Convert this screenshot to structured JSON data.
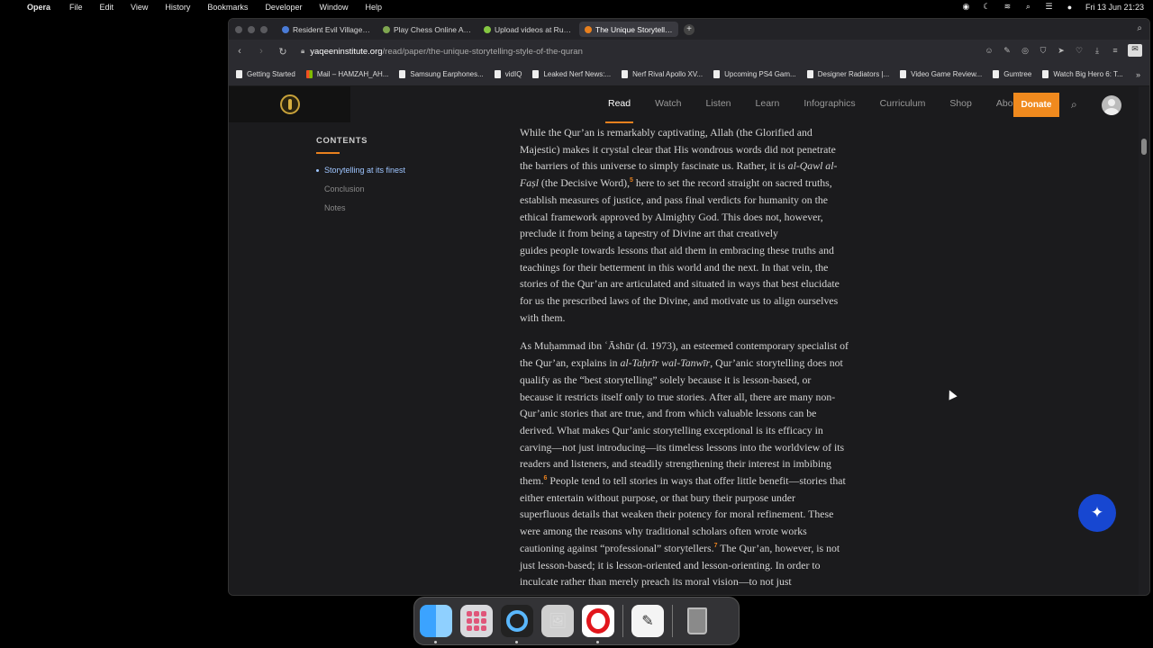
{
  "menubar": {
    "app": "Opera",
    "items": [
      "File",
      "Edit",
      "View",
      "History",
      "Bookmarks",
      "Developer",
      "Window",
      "Help"
    ],
    "clock": "Fri 13 Jun  21:23"
  },
  "tabs": [
    {
      "label": "Resident Evil Village - H",
      "color": "#4a7bd6"
    },
    {
      "label": "Play Chess Online Again",
      "color": "#7fa650"
    },
    {
      "label": "Upload videos at Rumble",
      "color": "#85c742"
    },
    {
      "label": "The Unique Storytelling",
      "color": "#e8801e",
      "active": true
    }
  ],
  "address": {
    "domain": "yaqeeninstitute.org",
    "path": "/read/paper/the-unique-storytelling-style-of-the-quran"
  },
  "bookmarks": [
    {
      "label": "Getting Started",
      "icon": "page"
    },
    {
      "label": "Mail – HAMZAH_AH...",
      "icon": "mail"
    },
    {
      "label": "Samsung Earphones...",
      "icon": "page"
    },
    {
      "label": "vidIQ",
      "icon": "page"
    },
    {
      "label": "Leaked Nerf News:...",
      "icon": "page"
    },
    {
      "label": "Nerf Rival Apollo XV...",
      "icon": "page"
    },
    {
      "label": "Upcoming PS4 Gam...",
      "icon": "page"
    },
    {
      "label": "Designer Radiators |...",
      "icon": "page"
    },
    {
      "label": "Video Game Review...",
      "icon": "page"
    },
    {
      "label": "Gumtree",
      "icon": "page"
    },
    {
      "label": "Watch Big Hero 6: T...",
      "icon": "page"
    }
  ],
  "site_nav": {
    "links": [
      "Read",
      "Watch",
      "Listen",
      "Learn",
      "Infographics",
      "Curriculum",
      "Shop",
      "About"
    ],
    "active": "Read",
    "donate": "Donate",
    "accent": "#f08a1e"
  },
  "toc": {
    "title": "CONTENTS",
    "items": [
      "Storytelling at its finest",
      "Conclusion",
      "Notes"
    ],
    "active": "Storytelling at its finest"
  },
  "article": {
    "p1": [
      "While the Qur’an is remarkably captivating, Allah (the Glorified and",
      "Majestic) makes it crystal clear that His wondrous words did not penetrate",
      "the barriers of this universe to simply fascinate us. Rather, it is ",
      "al-Qawl al-",
      "Faṣl",
      " (the Decisive Word),",
      "5",
      " here to set the record straight on sacred truths,",
      "establish measures of justice, and pass final verdicts for humanity on the",
      "ethical framework approved by Almighty God. This does not, however,",
      "preclude it from being a tapestry of Divine art that creatively",
      "guides people towards lessons that aid them in embracing these truths and",
      "teachings for their betterment in this world and the next. In that vein, the",
      "stories of the Qur’an are articulated and situated in ways that best elucidate",
      "for us the prescribed laws of the Divine, and motivate us to align ourselves",
      "with them."
    ],
    "p2": [
      "As Muḥammad ibn ʿĀshūr (d. 1973), an esteemed contemporary specialist of",
      "the Qur’an, explains in ",
      "al-Taḥrīr wal-Tanwīr",
      ", Qur’anic storytelling does not",
      "qualify as the “best storytelling” solely because it is lesson-based, or",
      "because it restricts itself only to true stories. After all, there are many non-",
      "Qur’anic stories that are true, and from which valuable lessons can be",
      "derived. What makes Qur’anic storytelling exceptional is its efficacy in",
      "carving—not just introducing—its timeless lessons into the worldview of its",
      "readers and listeners, and steadily strengthening their interest in imbibing",
      "them.",
      "6",
      " People tend to tell stories in ways that offer little benefit—stories that",
      "either entertain without purpose, or that bury their purpose under",
      "superfluous details that weaken their potency for moral refinement. These",
      "were among the reasons why traditional scholars often wrote works",
      "cautioning against “professional” storytellers.",
      "7",
      " The Qur’an, however, is not",
      "just lesson-based; it is lesson-oriented and lesson-orienting. In order to",
      "inculcate rather than merely preach its moral vision—to not just"
    ]
  },
  "fab": {
    "icon": "sparkle-icon",
    "color": "#1747d1"
  },
  "dock": [
    "finder",
    "launchpad",
    "quicktime",
    "preview",
    "opera",
    "textedit",
    "trash"
  ]
}
